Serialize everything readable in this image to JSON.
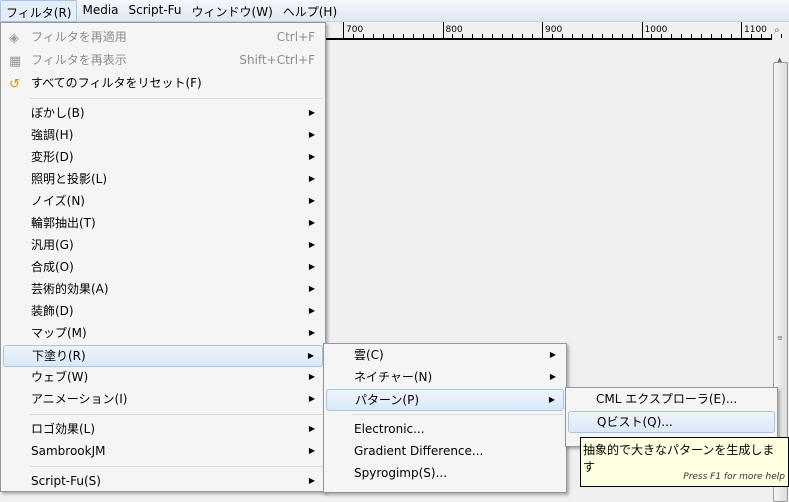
{
  "menubar": [
    "フィルタ(R)",
    "Media",
    "Script-Fu",
    "ウィンドウ(W)",
    "ヘルプ(H)"
  ],
  "ruler": {
    "labels": [
      "700",
      "800",
      "900",
      "1000",
      "1100"
    ]
  },
  "filters_menu": [
    {
      "label": "フィルタを再適用",
      "shortcut": "Ctrl+F",
      "disabled": true,
      "icon": "reapply-icon"
    },
    {
      "label": "フィルタを再表示",
      "shortcut": "Shift+Ctrl+F",
      "disabled": true,
      "icon": "reshow-icon"
    },
    {
      "label": "すべてのフィルタをリセット(F)",
      "icon": "reset-icon"
    },
    {
      "label": "ぼかし(B)",
      "submenu": true
    },
    {
      "label": "強調(H)",
      "submenu": true
    },
    {
      "label": "変形(D)",
      "submenu": true
    },
    {
      "label": "照明と投影(L)",
      "submenu": true
    },
    {
      "label": "ノイズ(N)",
      "submenu": true
    },
    {
      "label": "輪郭抽出(T)",
      "submenu": true
    },
    {
      "label": "汎用(G)",
      "submenu": true
    },
    {
      "label": "合成(O)",
      "submenu": true
    },
    {
      "label": "芸術的効果(A)",
      "submenu": true
    },
    {
      "label": "装飾(D)",
      "submenu": true
    },
    {
      "label": "マップ(M)",
      "submenu": true
    },
    {
      "label": "下塗り(R)",
      "submenu": true,
      "highlighted": true
    },
    {
      "label": "ウェブ(W)",
      "submenu": true
    },
    {
      "label": "アニメーション(I)",
      "submenu": true
    },
    {
      "label": "ロゴ効果(L)",
      "submenu": true
    },
    {
      "label": "SambrookJM",
      "submenu": true
    },
    {
      "label": "Script-Fu(S)",
      "submenu": true
    }
  ],
  "render_menu": [
    {
      "label": "雲(C)",
      "submenu": true
    },
    {
      "label": "ネイチャー(N)",
      "submenu": true
    },
    {
      "label": "パターン(P)",
      "submenu": true,
      "highlighted": true
    },
    {
      "label": "Electronic..."
    },
    {
      "label": "Gradient Difference..."
    },
    {
      "label": "Spyrogimp(S)..."
    }
  ],
  "pattern_menu": [
    {
      "label": "CML エクスプローラ(E)..."
    },
    {
      "label": "Qビスト(Q)...",
      "highlighted": true
    }
  ],
  "tooltip": {
    "text": "抽象的で大きなパターンを生成します",
    "hint": "Press F1 for more help"
  }
}
